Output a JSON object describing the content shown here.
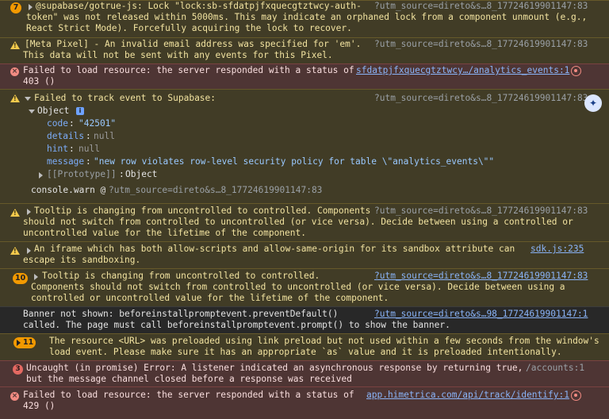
{
  "messages": [
    {
      "count": "7",
      "lines": [
        "@supabase/gotrue-js: Lock \"lock:sb-sfdatpjfxquecgtztwcy-auth-",
        "token\" was not released within 5000ms. This may indicate an orphaned lock from a component unmount (e.g.,",
        "React Strict Mode). Forcefully acquiring the lock to recover."
      ],
      "source": "?utm_source=direto&s…8_17724619901147:83"
    },
    {
      "lines": [
        "[Meta Pixel] - An invalid email address was specified for 'em'.",
        "This data will not be sent with any events for this Pixel."
      ],
      "source": "?utm_source=direto&s…8_17724619901147:83"
    },
    {
      "lines": [
        "Failed to load resource: the server responded with a status of",
        "403 ()"
      ],
      "source": "sfdatpjfxquecgtztwcy…/analytics_events:1"
    },
    {
      "header": "Failed to track event to Supabase:",
      "source": "?utm_source=direto&s…8_17724619901147:83",
      "object_label": "Object",
      "info_badge": "i",
      "fields": [
        {
          "key": "code",
          "value": "\"42501\""
        },
        {
          "key": "details",
          "value": "null"
        },
        {
          "key": "hint",
          "value": "null"
        },
        {
          "key": "message",
          "value": "\"new row violates row-level security policy for table \\\"analytics_events\\\"\""
        }
      ],
      "prototype_key": "[[Prototype]]",
      "prototype_value": "Object",
      "trace_fn": "console.warn @",
      "trace_src": "?utm_source=direto&s…8_17724619901147:83"
    },
    {
      "lines": [
        "Tooltip is changing from uncontrolled to controlled. Components",
        "should not switch from controlled to uncontrolled (or vice versa). Decide between using a controlled or",
        "uncontrolled value for the lifetime of the component."
      ],
      "source": "?utm_source=direto&s…8_17724619901147:83"
    },
    {
      "lines": [
        "An iframe which has both allow-scripts and allow-same-origin for its sandbox attribute can",
        "escape its sandboxing."
      ],
      "source": "sdk.js:235"
    },
    {
      "count": "10",
      "lines": [
        "Tooltip is changing from uncontrolled to controlled.",
        "Components should not switch from controlled to uncontrolled (or vice versa). Decide between using a",
        "controlled or uncontrolled value for the lifetime of the component."
      ],
      "source": "?utm_source=direto&s…8_17724619901147:83"
    },
    {
      "lines": [
        "Banner not shown: beforeinstallpromptevent.preventDefault()",
        "called. The page must call beforeinstallpromptevent.prompt() to show the banner."
      ],
      "source": "?utm_source=direto&s…98_17724619901147:1"
    },
    {
      "count": "11",
      "lines": [
        "The resource <URL> was preloaded using link preload but not used within a few seconds from the window's",
        "load event. Please make sure it has an appropriate `as` value and it is preloaded intentionally."
      ]
    },
    {
      "count": "3",
      "lines": [
        "Uncaught (in promise) Error: A listener indicated an asynchronous response by returning true,",
        "but the message channel closed before a response was received"
      ],
      "source": "/accounts:1"
    },
    {
      "lines": [
        "Failed to load resource: the server responded with a status of",
        "429 ()"
      ],
      "source": "app.himetrica.com/api/track/identify:1"
    }
  ],
  "ai_assist_icon": "lightbulb-sparkle"
}
